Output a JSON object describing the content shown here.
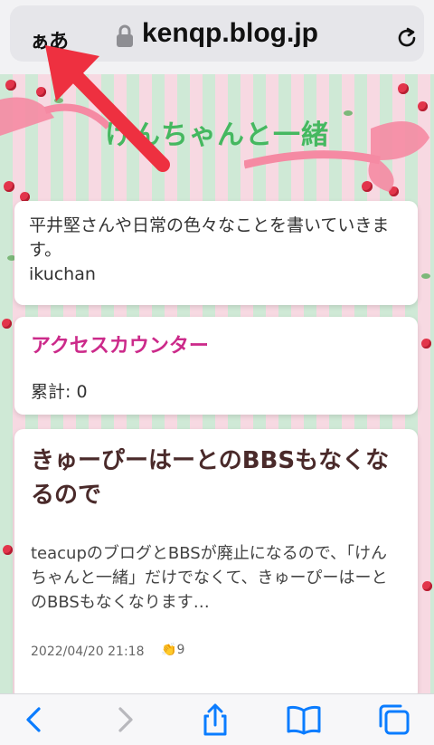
{
  "browser": {
    "text_size_button": "ぁあ",
    "domain": "kenqp.blog.jp"
  },
  "blog": {
    "title": "けんちゃんと一緒",
    "description": "平井堅さんや日常の色々なことを書いていきます。",
    "author": "ikuchan"
  },
  "widget": {
    "title": "アクセスカウンター",
    "counter": "累計: 0"
  },
  "post": {
    "title": "きゅーぴーはーとのBBSもなくなるので",
    "excerpt": "teacupのブログとBBSが廃止になるので、「けんちゃんと一緒」だけでなくて、きゅーぴーはーとのBBSもなくなります…",
    "date": "2022/04/20 21:18",
    "clap_count": "9"
  },
  "colors": {
    "title_green": "#45b860",
    "widget_pink": "#cc2a8a",
    "arrow_red": "#ee3040",
    "ios_blue": "#0a7cff"
  },
  "toolbar": {
    "icons": [
      "back-icon",
      "forward-icon",
      "share-icon",
      "bookmarks-icon",
      "tabs-icon"
    ]
  }
}
